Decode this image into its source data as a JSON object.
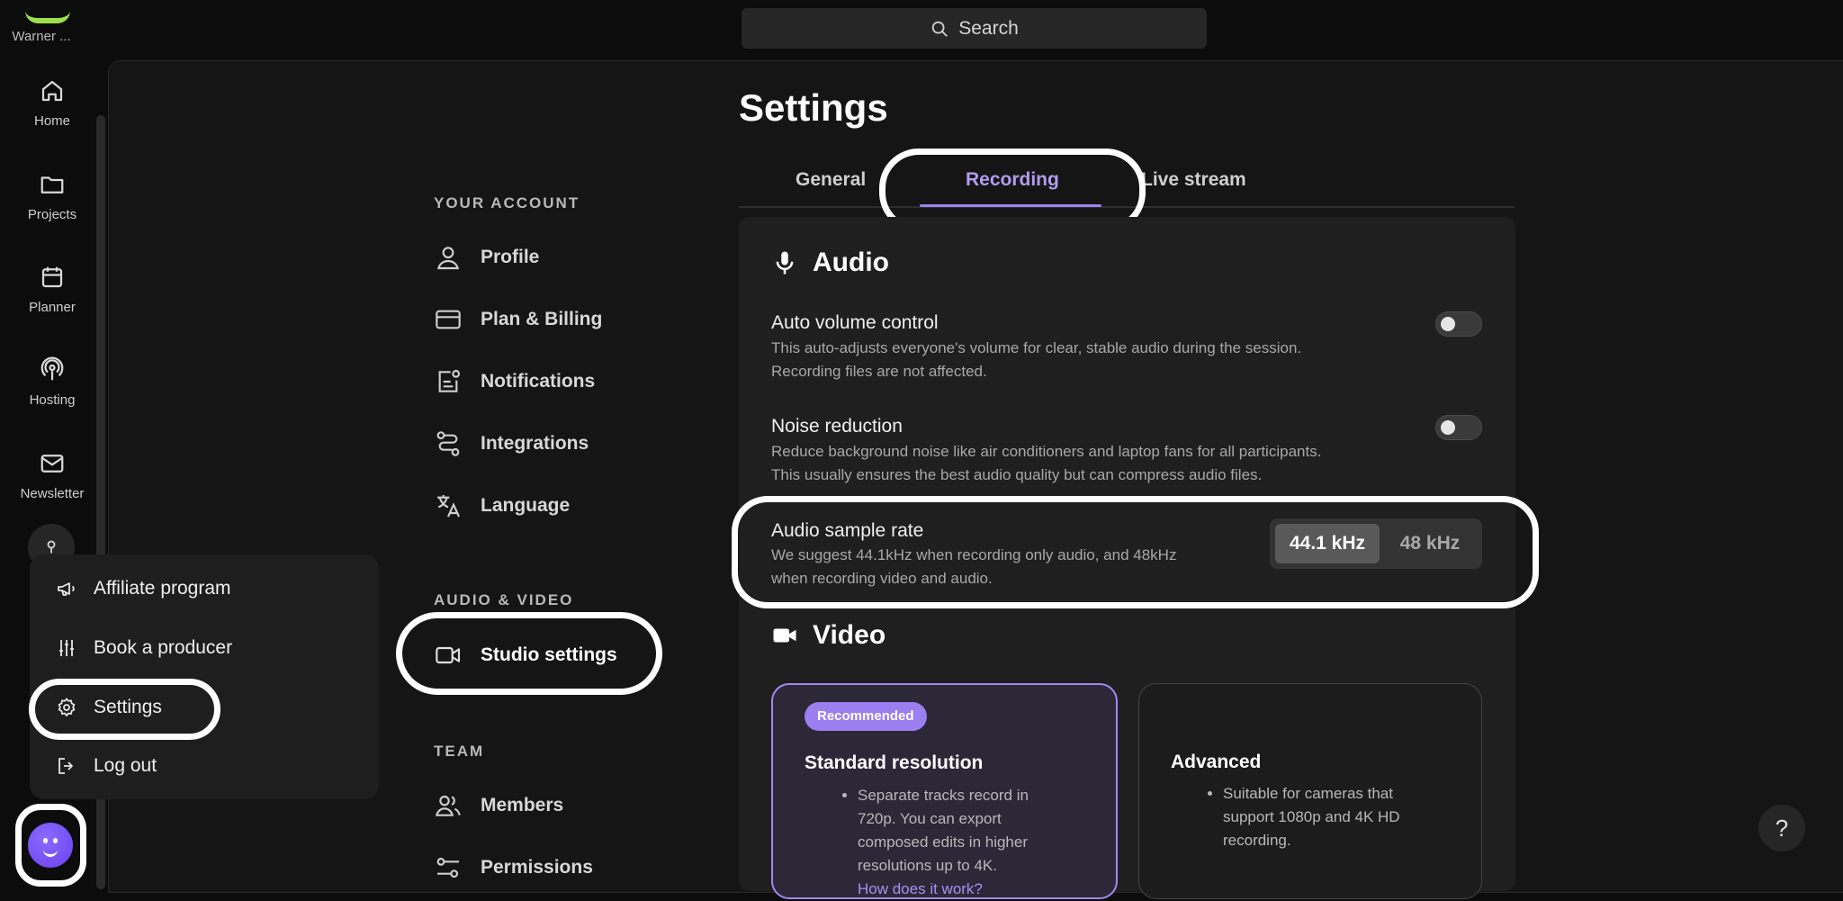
{
  "brand": {
    "name": "Warner ..."
  },
  "rail": [
    {
      "label": "Home",
      "icon": "home-icon"
    },
    {
      "label": "Projects",
      "icon": "folder-icon"
    },
    {
      "label": "Planner",
      "icon": "calendar-icon"
    },
    {
      "label": "Hosting",
      "icon": "podcast-icon"
    },
    {
      "label": "Newsletter",
      "icon": "mail-icon"
    }
  ],
  "search": {
    "label": "Search"
  },
  "page": {
    "title": "Settings"
  },
  "nav": {
    "sections": {
      "account": "YOUR ACCOUNT",
      "av": "AUDIO & VIDEO",
      "team": "TEAM"
    },
    "items": {
      "profile": "Profile",
      "plan": "Plan & Billing",
      "notifications": "Notifications",
      "integrations": "Integrations",
      "language": "Language",
      "studio": "Studio settings",
      "members": "Members",
      "permissions": "Permissions"
    }
  },
  "tabs": {
    "general": "General",
    "recording": "Recording",
    "livestream": "Live stream",
    "active": "Recording"
  },
  "audio": {
    "heading": "Audio",
    "auto_volume": {
      "title": "Auto volume control",
      "desc1": "This auto-adjusts everyone's volume for clear, stable audio during the session.",
      "desc2": "Recording files are not affected.",
      "enabled": false
    },
    "noise": {
      "title": "Noise reduction",
      "desc1": "Reduce background noise like air conditioners and laptop fans for all participants.",
      "desc2": "This usually ensures the best audio quality but can compress audio files.",
      "enabled": false
    },
    "sample_rate": {
      "title": "Audio sample rate",
      "desc1": "We suggest 44.1kHz when recording only audio, and 48kHz",
      "desc2": "when recording video and audio.",
      "options": [
        "44.1 kHz",
        "48 kHz"
      ],
      "selected": "44.1 kHz"
    }
  },
  "video": {
    "heading": "Video",
    "standard": {
      "badge": "Recommended",
      "title": "Standard resolution",
      "bullet": [
        "Separate tracks record in",
        "720p. You can export",
        "composed edits in higher",
        "resolutions up to 4K."
      ],
      "link": "How does it work?"
    },
    "advanced": {
      "title": "Advanced",
      "bullet": [
        "Suitable for cameras that",
        "support 1080p and 4K HD",
        "recording."
      ]
    }
  },
  "menu": {
    "affiliate": "Affiliate program",
    "book": "Book a producer",
    "settings": "Settings",
    "logout": "Log out"
  },
  "help": {
    "label": "?"
  },
  "colors": {
    "accent": "#9b83ee",
    "brand": "#9ee04a",
    "panel": "#151515",
    "card": "#1f1f1f"
  }
}
